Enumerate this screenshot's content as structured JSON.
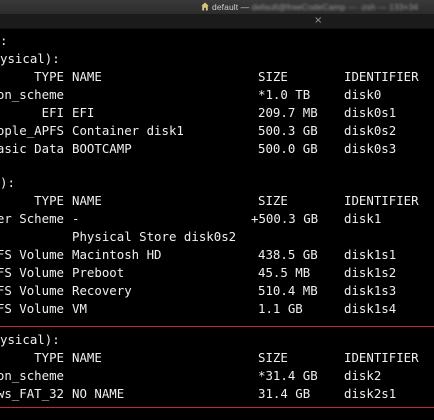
{
  "titlebar": {
    "title_visible": "default — ",
    "title_blurred": "default@freeCodeCamp — -zsh — 133×34"
  },
  "terminal": {
    "line_colon": ":",
    "disk0": {
      "header": "ysical):",
      "columns": {
        "type": "TYPE",
        "name": "NAME",
        "size": "SIZE",
        "identifier": "IDENTIFIER"
      },
      "rows": [
        {
          "type": "on_scheme",
          "name": "",
          "size": "*1.0 TB",
          "identifier": "disk0"
        },
        {
          "type": "EFI",
          "name": "EFI",
          "size": "209.7 MB",
          "identifier": "disk0s1"
        },
        {
          "type": "ople_APFS",
          "name": "Container disk1",
          "size": "500.3 GB",
          "identifier": "disk0s2"
        },
        {
          "type": "asic Data",
          "name": "BOOTCAMP",
          "size": "500.0 GB",
          "identifier": "disk0s3"
        }
      ]
    },
    "disk1": {
      "header": "):",
      "columns": {
        "type": "TYPE",
        "name": "NAME",
        "size": "SIZE",
        "identifier": "IDENTIFIER"
      },
      "rows": [
        {
          "type": "er Scheme",
          "name": "-",
          "size": "+500.3 GB",
          "identifier": "disk1"
        },
        {
          "type": "",
          "name": "Physical Store disk0s2",
          "size": "",
          "identifier": ""
        },
        {
          "type": "FS Volume",
          "name": "Macintosh HD",
          "size": "438.5 GB",
          "identifier": "disk1s1"
        },
        {
          "type": "FS Volume",
          "name": "Preboot",
          "size": "45.5 MB",
          "identifier": "disk1s2"
        },
        {
          "type": "FS Volume",
          "name": "Recovery",
          "size": "510.4 MB",
          "identifier": "disk1s3"
        },
        {
          "type": "FS Volume",
          "name": "VM",
          "size": "1.1 GB",
          "identifier": "disk1s4"
        }
      ]
    },
    "disk2": {
      "header": "ysical):",
      "columns": {
        "type": "TYPE",
        "name": "NAME",
        "size": "SIZE",
        "identifier": "IDENTIFIER"
      },
      "rows": [
        {
          "type": "on_scheme",
          "name": "",
          "size": "*31.4 GB",
          "identifier": "disk2"
        },
        {
          "type": "ws_FAT_32",
          "name": "NO NAME",
          "size": "31.4 GB",
          "identifier": "disk2s1"
        }
      ]
    }
  },
  "icons": {
    "title_icon": "home-icon",
    "tab_close": "close-icon"
  },
  "colors": {
    "background": "#000000",
    "text": "#f0f0f0",
    "highlight_border": "#c62828",
    "titlebar": "#333333"
  },
  "tabbar": {
    "close_glyph": "×"
  }
}
